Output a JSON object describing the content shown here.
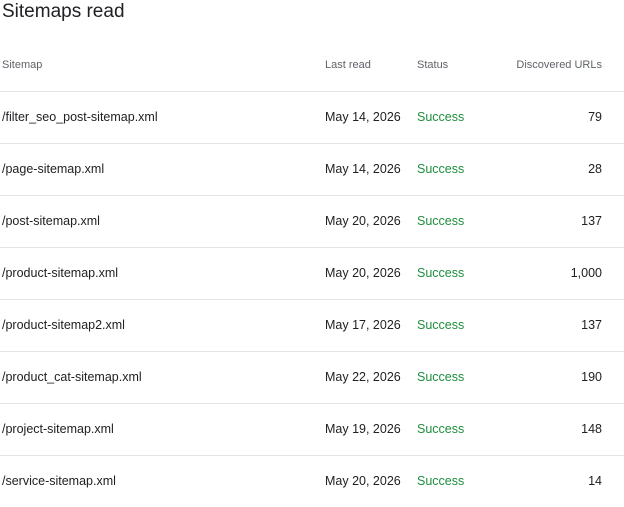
{
  "page": {
    "title": "Sitemaps read"
  },
  "table": {
    "columns": {
      "sitemap": "Sitemap",
      "last_read": "Last read",
      "status": "Status",
      "discovered_urls": "Discovered URLs"
    },
    "rows": [
      {
        "sitemap": "/filter_seo_post-sitemap.xml",
        "last_read": "May 14, 2026",
        "status": "Success",
        "discovered_urls": "79"
      },
      {
        "sitemap": "/page-sitemap.xml",
        "last_read": "May 14, 2026",
        "status": "Success",
        "discovered_urls": "28"
      },
      {
        "sitemap": "/post-sitemap.xml",
        "last_read": "May 20, 2026",
        "status": "Success",
        "discovered_urls": "137"
      },
      {
        "sitemap": "/product-sitemap.xml",
        "last_read": "May 20, 2026",
        "status": "Success",
        "discovered_urls": "1,000"
      },
      {
        "sitemap": "/product-sitemap2.xml",
        "last_read": "May 17, 2026",
        "status": "Success",
        "discovered_urls": "137"
      },
      {
        "sitemap": "/product_cat-sitemap.xml",
        "last_read": "May 22, 2026",
        "status": "Success",
        "discovered_urls": "190"
      },
      {
        "sitemap": "/project-sitemap.xml",
        "last_read": "May 19, 2026",
        "status": "Success",
        "discovered_urls": "148"
      },
      {
        "sitemap": "/service-sitemap.xml",
        "last_read": "May 20, 2026",
        "status": "Success",
        "discovered_urls": "14"
      }
    ]
  },
  "colors": {
    "text": "#202124",
    "header_text": "#5f6368",
    "success": "#1e8e3e",
    "divider": "#e3e3e3"
  }
}
